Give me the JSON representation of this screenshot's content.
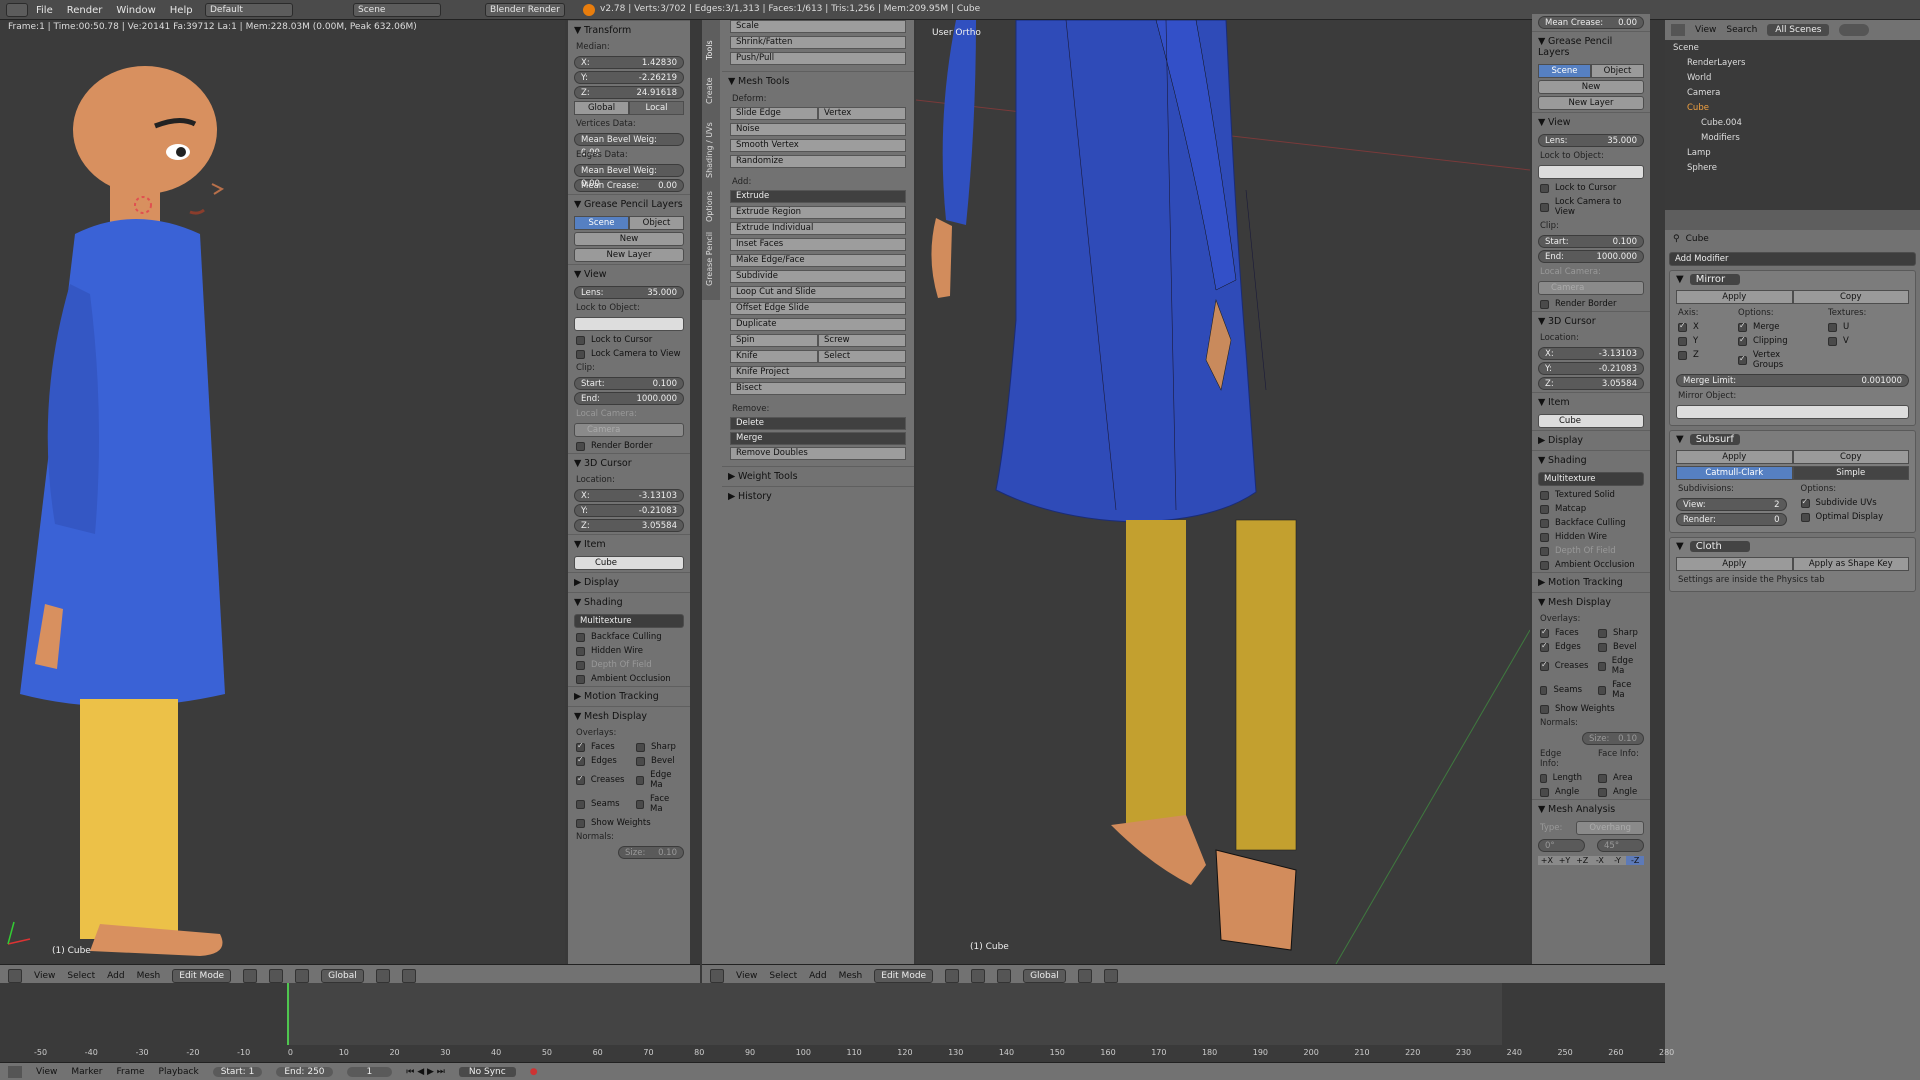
{
  "topbar": {
    "menus": [
      "File",
      "Render",
      "Window",
      "Help"
    ],
    "layout": "Default",
    "scene": "Scene",
    "engine": "Blender Render",
    "stats": "v2.78 | Verts:3/702 | Edges:3/1,313 | Faces:1/613 | Tris:1,256 | Mem:209.95M | Cube"
  },
  "statline": "Frame:1 | Time:00:50.78 | Ve:20141 Fa:39712 La:1 | Mem:228.03M (0.00M, Peak 632.06M)",
  "left_vp": {
    "label": "(1) Cube"
  },
  "right_vp": {
    "view_name": "User Ortho",
    "label": "(1) Cube"
  },
  "npanel_left": {
    "transform": "Transform",
    "median": "Median:",
    "x": "1.42830",
    "y": "-2.26219",
    "z": "24.91618",
    "global": "Global",
    "local": "Local",
    "vdata": "Vertices Data:",
    "mbw": "Mean Bevel Weig: 0.00",
    "edata": "Edges Data:",
    "mbw2": "Mean Bevel Weig: 0.00",
    "mcrease": "Mean Crease:",
    "mcrease_v": "0.00",
    "gp": "Grease Pencil Layers",
    "scene": "Scene",
    "object": "Object",
    "new": "New",
    "newlayer": "New Layer",
    "view": "View",
    "lens": "Lens:",
    "lens_v": "35.000",
    "lockobj": "Lock to Object:",
    "lockcursor": "Lock to Cursor",
    "lockcam": "Lock Camera to View",
    "clip": "Clip:",
    "start": "Start:",
    "start_v": "0.100",
    "end": "End:",
    "end_v": "1000.000",
    "localcam": "Local Camera:",
    "camera": "Camera",
    "renderborder": "Render Border",
    "cursor": "3D Cursor",
    "location": "Location:",
    "cx": "-3.13103",
    "cy": "-0.21083",
    "cz": "3.05584",
    "item": "Item",
    "itemname": "Cube",
    "display": "Display",
    "shading": "Shading",
    "multitex": "Multitexture",
    "backface": "Backface Culling",
    "hiddenwire": "Hidden Wire",
    "dof": "Depth Of Field",
    "ao": "Ambient Occlusion",
    "motion": "Motion Tracking",
    "meshdisp": "Mesh Display",
    "overlays": "Overlays:",
    "faces": "Faces",
    "sharp": "Sharp",
    "edges": "Edges",
    "bevel": "Bevel",
    "creases": "Creases",
    "edgema": "Edge Ma",
    "seams": "Seams",
    "facema": "Face Ma",
    "showweights": "Show Weights",
    "normals": "Normals:",
    "size": "Size:",
    "size_v": "0.10"
  },
  "toolshelf": {
    "tabs": [
      "Tools",
      "Create",
      "Shading / UVs",
      "Options",
      "Grease Pencil"
    ],
    "top": [
      "Scale",
      "Shrink/Fatten",
      "Push/Pull"
    ],
    "meshtools": "Mesh Tools",
    "deform": "Deform:",
    "slide_edge": "Slide Edge",
    "vertex": "Vertex",
    "noise": "Noise",
    "smooth": "Smooth Vertex",
    "randomize": "Randomize",
    "add": "Add:",
    "extrude": "Extrude",
    "add_items": [
      "Extrude Region",
      "Extrude Individual",
      "Inset Faces",
      "Make Edge/Face",
      "Subdivide",
      "Loop Cut and Slide",
      "Offset Edge Slide",
      "Duplicate"
    ],
    "spin": "Spin",
    "screw": "Screw",
    "knife": "Knife",
    "select": "Select",
    "knifeproj": "Knife Project",
    "bisect": "Bisect",
    "remove": "Remove:",
    "delete": "Delete",
    "merge": "Merge",
    "removedoubles": "Remove Doubles",
    "weight": "Weight Tools",
    "history": "History"
  },
  "npanel_right": {
    "meancrease": "Mean Crease:",
    "meancrease_v": "0.00",
    "gp": "Grease Pencil Layers",
    "scene": "Scene",
    "object": "Object",
    "new": "New",
    "newlayer": "New Layer",
    "view": "View",
    "lens": "Lens:",
    "lens_v": "35.000",
    "lockobj": "Lock to Object:",
    "lockcursor": "Lock to Cursor",
    "lockcam": "Lock Camera to View",
    "clip": "Clip:",
    "start": "Start:",
    "start_v": "0.100",
    "end": "End:",
    "end_v": "1000.000",
    "localcam": "Local Camera:",
    "camera": "Camera",
    "renderborder": "Render Border",
    "cursor": "3D Cursor",
    "location": "Location:",
    "cx": "-3.13103",
    "cy": "-0.21083",
    "cz": "3.05584",
    "item": "Item",
    "itemname": "Cube",
    "display": "Display",
    "shading": "Shading",
    "multitex": "Multitexture",
    "textured": "Textured Solid",
    "matcap": "Matcap",
    "backface": "Backface Culling",
    "hiddenwire": "Hidden Wire",
    "dof": "Depth Of Field",
    "ao": "Ambient Occlusion",
    "motion": "Motion Tracking",
    "meshdisp": "Mesh Display",
    "overlays": "Overlays:",
    "faces": "Faces",
    "sharp": "Sharp",
    "edges": "Edges",
    "bevel": "Bevel",
    "creases": "Creases",
    "edgema": "Edge Ma",
    "seams": "Seams",
    "facema": "Face Ma",
    "showweights": "Show Weights",
    "normals": "Normals:",
    "size": "Size:",
    "size_v": "0.10",
    "edgeinfo": "Edge Info:",
    "faceinfo": "Face Info:",
    "length": "Length",
    "area": "Area",
    "angle": "Angle",
    "angle2": "Angle",
    "meshanalysis": "Mesh Analysis",
    "type": "Type:",
    "overhang": "Overhang",
    "deg0": "0°",
    "deg45": "45°",
    "axes": [
      "+X",
      "+Y",
      "+Z",
      "-X",
      "-Y",
      "-Z"
    ]
  },
  "viewheader": {
    "items": [
      "View",
      "Select",
      "Add",
      "Mesh"
    ],
    "mode": "Edit Mode",
    "orient": "Global"
  },
  "outliner": {
    "menus": [
      "View",
      "Search"
    ],
    "scenes": "All Scenes",
    "tree": [
      "Scene",
      "RenderLayers",
      "World",
      "Camera",
      "Cube",
      "Cube.004",
      "Modifiers",
      "Lamp",
      "Sphere"
    ]
  },
  "props": {
    "object": "Cube",
    "addmod": "Add Modifier",
    "mirror": "Mirror",
    "apply": "Apply",
    "copy": "Copy",
    "axis": "Axis:",
    "options": "Options:",
    "textures": "Textures:",
    "x": "X",
    "y": "Y",
    "z": "Z",
    "merge": "Merge",
    "clipping": "Clipping",
    "vgroups": "Vertex Groups",
    "u": "U",
    "v": "V",
    "mergelimit": "Merge Limit:",
    "mergelimit_v": "0.001000",
    "mirrorobj": "Mirror Object:",
    "subsurf": "Subsurf",
    "catmull": "Catmull-Clark",
    "simple": "Simple",
    "subdivisions": "Subdivisions:",
    "viewlbl": "View:",
    "view_v": "2",
    "renderlbl": "Render:",
    "render_v": "0",
    "subuv": "Subdivide UVs",
    "optimal": "Optimal Display",
    "cloth": "Cloth",
    "applyshape": "Apply as Shape Key",
    "clothnote": "Settings are inside the Physics tab"
  },
  "timeline": {
    "ticks": [
      "-50",
      "-40",
      "-30",
      "-20",
      "-10",
      "0",
      "10",
      "20",
      "30",
      "40",
      "50",
      "60",
      "70",
      "80",
      "90",
      "100",
      "110",
      "120",
      "130",
      "140",
      "150",
      "160",
      "170",
      "180",
      "190",
      "200",
      "210",
      "220",
      "230",
      "240",
      "250",
      "260",
      "280"
    ],
    "menus": [
      "View",
      "Marker",
      "Frame",
      "Playback"
    ],
    "start": "Start:",
    "start_v": "1",
    "end": "End:",
    "end_v": "250",
    "frame_v": "1",
    "sync": "No Sync"
  }
}
